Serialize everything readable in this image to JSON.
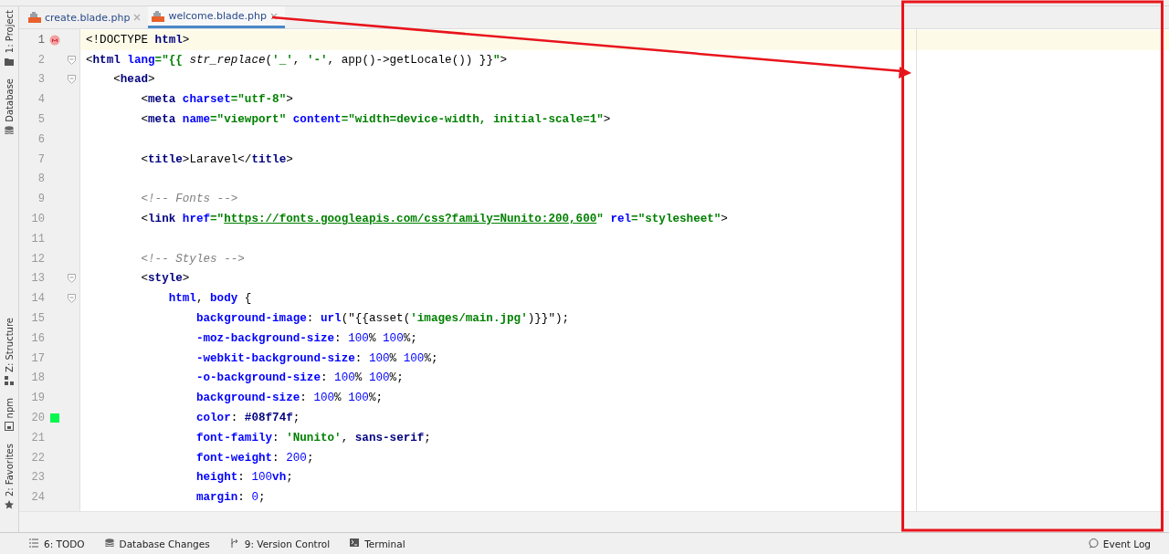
{
  "tabs": [
    {
      "label": "create.blade.php",
      "selected": false
    },
    {
      "label": "welcome.blade.php",
      "selected": true
    }
  ],
  "left_toolbar": [
    {
      "label": "1: Project",
      "kind": "folder"
    },
    {
      "label": "Database",
      "kind": "database"
    },
    {
      "label": "Z: Structure",
      "kind": "structure"
    },
    {
      "label": "npm",
      "kind": "npm"
    },
    {
      "label": "2: Favorites",
      "kind": "star"
    }
  ],
  "editor": {
    "lines": [
      {
        "number": "1",
        "current": true,
        "kind": "breakpoint",
        "fold": false,
        "tokens": [
          {
            "kind": "tag",
            "text": "<!DOCTYPE "
          },
          {
            "kind": "name",
            "text": "html"
          },
          {
            "kind": "tag",
            "text": ">"
          }
        ]
      },
      {
        "number": "2",
        "current": false,
        "fold": true,
        "tokens": [
          {
            "kind": "tag",
            "text": "<"
          },
          {
            "kind": "name",
            "text": "html "
          },
          {
            "kind": "attr",
            "text": "lang"
          },
          {
            "kind": "str",
            "text": "=\"{{ "
          },
          {
            "kind": "italic",
            "text": "str_replace"
          },
          {
            "kind": "plain",
            "text": "("
          },
          {
            "kind": "str",
            "text": "'_'"
          },
          {
            "kind": "plain",
            "text": ", "
          },
          {
            "kind": "str",
            "text": "'-'"
          },
          {
            "kind": "plain",
            "text": ", app()->getLocale()) }}"
          },
          {
            "kind": "str",
            "text": "\""
          },
          {
            "kind": "tag",
            "text": ">"
          }
        ]
      },
      {
        "number": "3",
        "current": false,
        "fold": true,
        "tokens": [
          {
            "kind": "tag",
            "text": "    <"
          },
          {
            "kind": "name",
            "text": "head"
          },
          {
            "kind": "tag",
            "text": ">"
          }
        ]
      },
      {
        "number": "4",
        "current": false,
        "fold": false,
        "tokens": [
          {
            "kind": "tag",
            "text": "        <"
          },
          {
            "kind": "name",
            "text": "meta "
          },
          {
            "kind": "attr",
            "text": "charset"
          },
          {
            "kind": "str",
            "text": "=\"utf-8\""
          },
          {
            "kind": "tag",
            "text": ">"
          }
        ]
      },
      {
        "number": "5",
        "current": false,
        "fold": false,
        "tokens": [
          {
            "kind": "tag",
            "text": "        <"
          },
          {
            "kind": "name",
            "text": "meta "
          },
          {
            "kind": "attr",
            "text": "name"
          },
          {
            "kind": "str",
            "text": "=\"viewport\" "
          },
          {
            "kind": "attr",
            "text": "content"
          },
          {
            "kind": "str",
            "text": "=\"width=device-width, initial-scale=1\""
          },
          {
            "kind": "tag",
            "text": ">"
          }
        ]
      },
      {
        "number": "6",
        "current": false,
        "fold": false
      },
      {
        "number": "7",
        "current": false,
        "fold": false,
        "tokens": [
          {
            "kind": "tag",
            "text": "        <"
          },
          {
            "kind": "name",
            "text": "title"
          },
          {
            "kind": "tag",
            "text": ">"
          },
          {
            "kind": "plain",
            "text": "Laravel"
          },
          {
            "kind": "tag",
            "text": "</"
          },
          {
            "kind": "name",
            "text": "title"
          },
          {
            "kind": "tag",
            "text": ">"
          }
        ]
      },
      {
        "number": "8",
        "current": false,
        "fold": false
      },
      {
        "number": "9",
        "current": false,
        "fold": false,
        "tokens": [
          {
            "kind": "comment",
            "text": "        <!-- Fonts -->"
          }
        ]
      },
      {
        "number": "10",
        "current": false,
        "fold": false,
        "tokens": [
          {
            "kind": "tag",
            "text": "        <"
          },
          {
            "kind": "name",
            "text": "link "
          },
          {
            "kind": "attr",
            "text": "href"
          },
          {
            "kind": "str",
            "text": "=\""
          },
          {
            "kind": "url",
            "text": "https://fonts.googleapis.com/css?family=Nunito:200,600"
          },
          {
            "kind": "str",
            "text": "\" "
          },
          {
            "kind": "attr",
            "text": "rel"
          },
          {
            "kind": "str",
            "text": "=\"stylesheet\""
          },
          {
            "kind": "tag",
            "text": ">"
          }
        ]
      },
      {
        "number": "11",
        "current": false,
        "fold": false
      },
      {
        "number": "12",
        "current": false,
        "fold": false,
        "tokens": [
          {
            "kind": "comment",
            "text": "        <!-- Styles -->"
          }
        ]
      },
      {
        "number": "13",
        "current": false,
        "fold": true,
        "tokens": [
          {
            "kind": "tag",
            "text": "        <"
          },
          {
            "kind": "name",
            "text": "style"
          },
          {
            "kind": "tag",
            "text": ">"
          }
        ]
      },
      {
        "number": "14",
        "current": false,
        "fold": true,
        "tokens": [
          {
            "kind": "prop",
            "text": "            html"
          },
          {
            "kind": "plain",
            "text": ", "
          },
          {
            "kind": "prop",
            "text": "body "
          },
          {
            "kind": "plain",
            "text": "{"
          }
        ]
      },
      {
        "number": "15",
        "current": false,
        "fold": false,
        "tokens": [
          {
            "kind": "prop",
            "text": "                background-image"
          },
          {
            "kind": "plain",
            "text": ": "
          },
          {
            "kind": "prop",
            "text": "url"
          },
          {
            "kind": "plain",
            "text": "(\"{{asset("
          },
          {
            "kind": "str",
            "text": "'images/main.jpg'"
          },
          {
            "kind": "plain",
            "text": ")}}\");"
          }
        ]
      },
      {
        "number": "16",
        "current": false,
        "fold": false,
        "tokens": [
          {
            "kind": "prop",
            "text": "                -moz-background-size"
          },
          {
            "kind": "plain",
            "text": ": "
          },
          {
            "kind": "num",
            "text": "100"
          },
          {
            "kind": "plain",
            "text": "% "
          },
          {
            "kind": "num",
            "text": "100"
          },
          {
            "kind": "plain",
            "text": "%;"
          }
        ]
      },
      {
        "number": "17",
        "current": false,
        "fold": false,
        "tokens": [
          {
            "kind": "prop",
            "text": "                -webkit-background-size"
          },
          {
            "kind": "plain",
            "text": ": "
          },
          {
            "kind": "num",
            "text": "100"
          },
          {
            "kind": "plain",
            "text": "% "
          },
          {
            "kind": "num",
            "text": "100"
          },
          {
            "kind": "plain",
            "text": "%;"
          }
        ]
      },
      {
        "number": "18",
        "current": false,
        "fold": false,
        "tokens": [
          {
            "kind": "prop",
            "text": "                -o-background-size"
          },
          {
            "kind": "plain",
            "text": ": "
          },
          {
            "kind": "num",
            "text": "100"
          },
          {
            "kind": "plain",
            "text": "% "
          },
          {
            "kind": "num",
            "text": "100"
          },
          {
            "kind": "plain",
            "text": "%;"
          }
        ]
      },
      {
        "number": "19",
        "current": false,
        "fold": false,
        "tokens": [
          {
            "kind": "prop",
            "text": "                background-size"
          },
          {
            "kind": "plain",
            "text": ": "
          },
          {
            "kind": "num",
            "text": "100"
          },
          {
            "kind": "plain",
            "text": "% "
          },
          {
            "kind": "num",
            "text": "100"
          },
          {
            "kind": "plain",
            "text": "%;"
          }
        ]
      },
      {
        "number": "20",
        "current": false,
        "kind": "swatch",
        "color": "#08f74f",
        "fold": false,
        "tokens": [
          {
            "kind": "prop",
            "text": "                color"
          },
          {
            "kind": "plain",
            "text": ": "
          },
          {
            "kind": "hex",
            "text": "#08f74f"
          },
          {
            "kind": "plain",
            "text": ";"
          }
        ]
      },
      {
        "number": "21",
        "current": false,
        "fold": false,
        "tokens": [
          {
            "kind": "prop",
            "text": "                font-family"
          },
          {
            "kind": "plain",
            "text": ": "
          },
          {
            "kind": "str",
            "text": "'Nunito'"
          },
          {
            "kind": "plain",
            "text": ", "
          },
          {
            "kind": "hex",
            "text": "sans-serif"
          },
          {
            "kind": "plain",
            "text": ";"
          }
        ]
      },
      {
        "number": "22",
        "current": false,
        "fold": false,
        "tokens": [
          {
            "kind": "prop",
            "text": "                font-weight"
          },
          {
            "kind": "plain",
            "text": ": "
          },
          {
            "kind": "num",
            "text": "200"
          },
          {
            "kind": "plain",
            "text": ";"
          }
        ]
      },
      {
        "number": "23",
        "current": false,
        "fold": false,
        "tokens": [
          {
            "kind": "prop",
            "text": "                height"
          },
          {
            "kind": "plain",
            "text": ": "
          },
          {
            "kind": "num",
            "text": "100"
          },
          {
            "kind": "prop",
            "text": "vh"
          },
          {
            "kind": "plain",
            "text": ";"
          }
        ]
      },
      {
        "number": "24",
        "current": false,
        "fold": false,
        "tokens": [
          {
            "kind": "prop",
            "text": "                margin"
          },
          {
            "kind": "plain",
            "text": ": "
          },
          {
            "kind": "num",
            "text": "0"
          },
          {
            "kind": "plain",
            "text": ";"
          }
        ]
      }
    ]
  },
  "status_bar": [
    {
      "label": "6: TODO",
      "kind": "list"
    },
    {
      "label": "Database Changes",
      "kind": "database"
    },
    {
      "label": "9: Version Control",
      "kind": "branch"
    },
    {
      "label": "Terminal",
      "kind": "terminal"
    },
    {
      "label": "Event Log",
      "kind": "bubble"
    }
  ],
  "annotation": {
    "arrow": true,
    "frame": true
  }
}
